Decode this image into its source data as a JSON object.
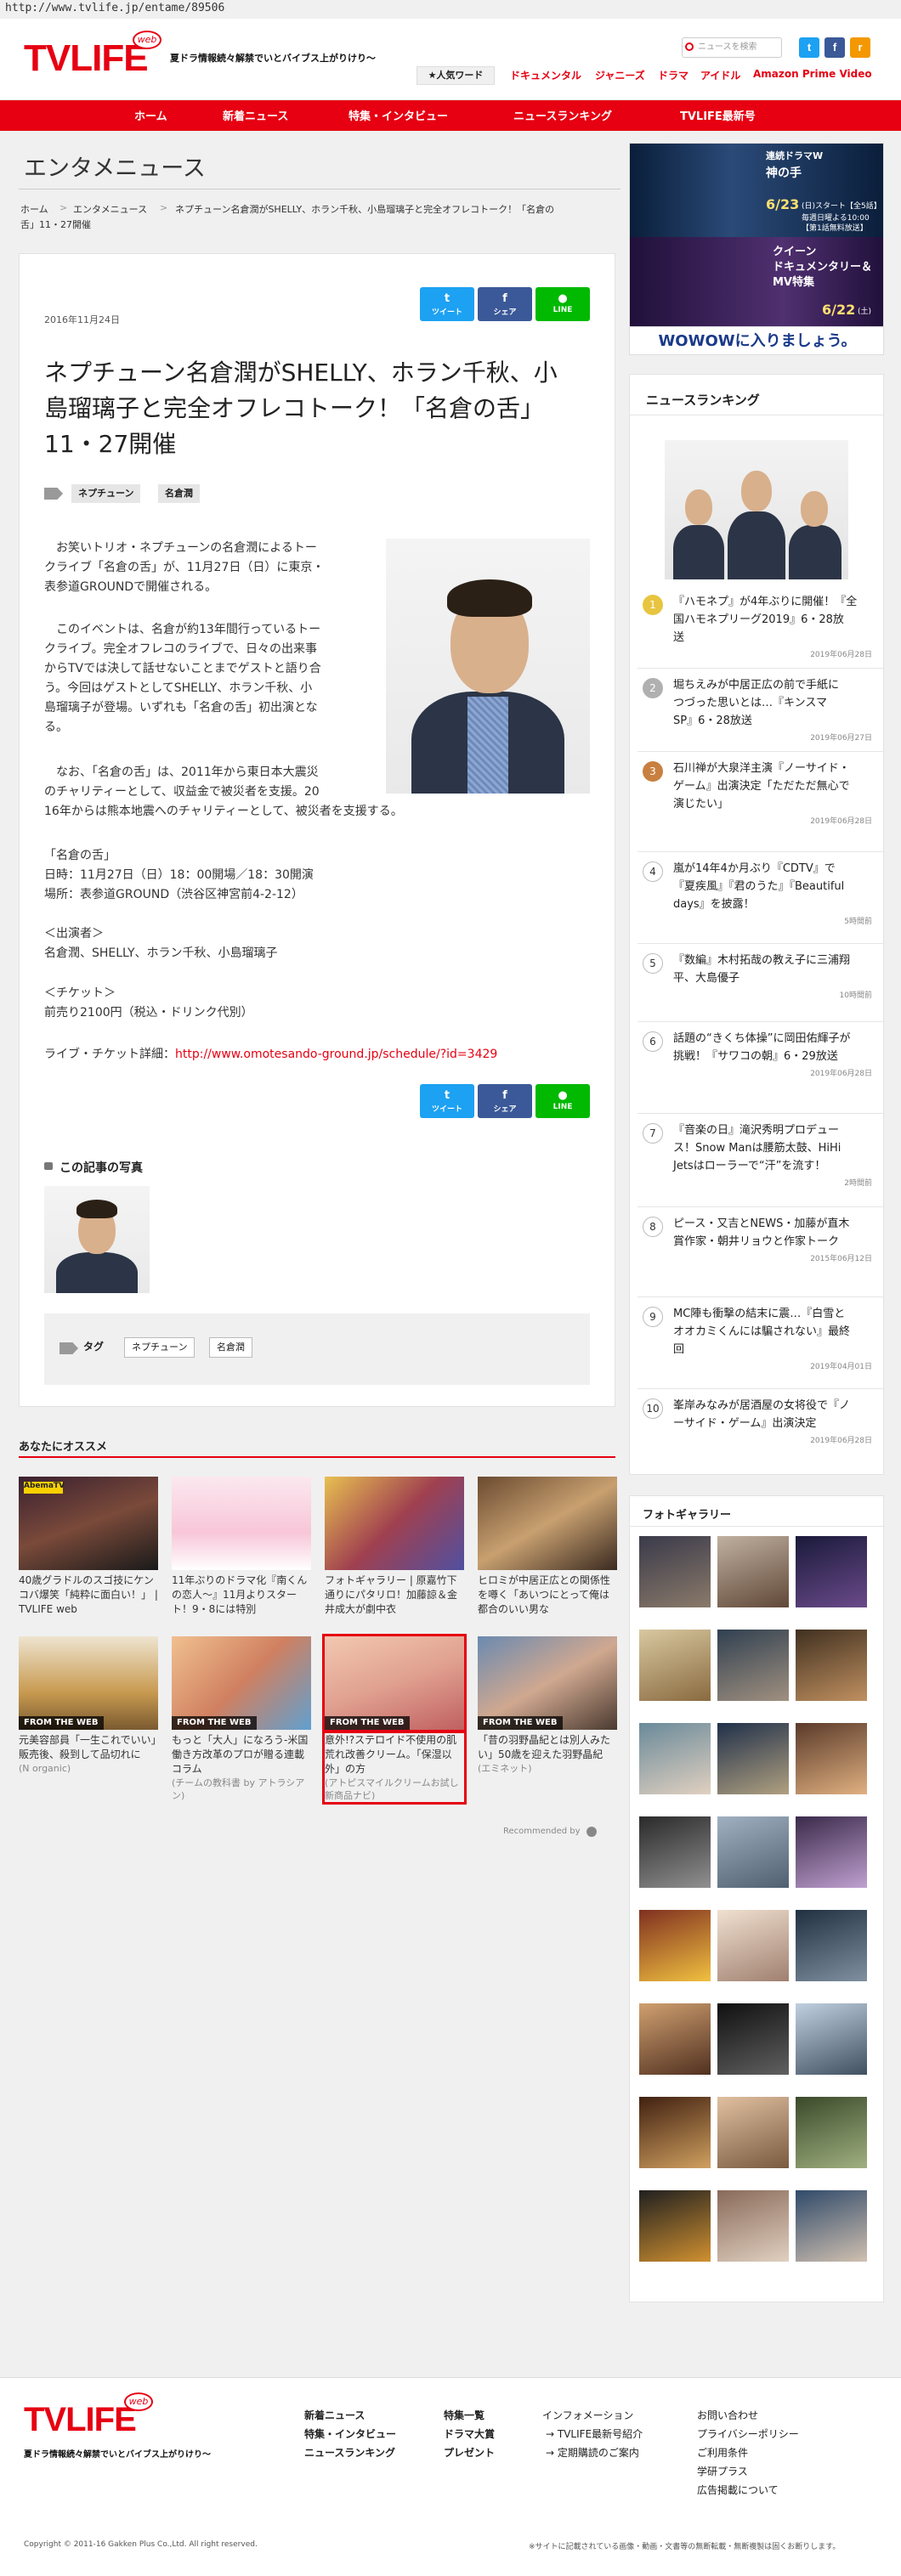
{
  "browser": {
    "url": "http://www.tvlife.jp/entame/89506"
  },
  "header": {
    "logo": "TVLIFE",
    "logo_web": "web",
    "tagline": "夏ドラ情報続々解禁でいとバイブス上がりけり〜",
    "search_placeholder": "ニュースを検索",
    "popular_label": "★人気ワード",
    "categories": [
      "ドキュメンタル",
      "ジャニーズ",
      "ドラマ",
      "アイドル",
      "Amazon Prime Video"
    ],
    "social": {
      "twitter": "t",
      "facebook": "f",
      "rss": "r"
    }
  },
  "nav": {
    "items": [
      "ホーム",
      "新着ニュース",
      "特集・インタビュー",
      "ニュースランキング",
      "TVLIFE最新号"
    ]
  },
  "page_heading": "エンタメニュース",
  "breadcrumb": {
    "home": "ホーム",
    "sep": ">",
    "section": "エンタメニュース",
    "current1": "ネプチューン名倉潤がSHELLY、ホラン千秋、小島瑠璃子と完全オフレコトーク！「名倉の",
    "current2": "舌」11・27開催"
  },
  "article": {
    "date": "2016年11月24日",
    "share": {
      "tweet": "ツイート",
      "share": "シェア",
      "line": "LINE"
    },
    "title": "ネプチューン名倉潤がSHELLY、ホラン千秋、小島瑠璃子と完全オフレコトーク！「名倉の舌」11・27開催",
    "tags": [
      "ネプチューン",
      "名倉潤"
    ],
    "p1_lines": [
      "　お笑いトリオ・ネプチューンの名倉潤によるトー",
      "クライブ「名倉の舌」が、11月27日（日）に東京・",
      "表参道GROUNDで開催される。"
    ],
    "p2_lines": [
      "　このイベントは、名倉が約13年間行っているトー",
      "クライブ。完全オフレコのライブで、日々の出来事",
      "からTVでは決して話せないことまでゲストと語り合",
      "う。今回はゲストとしてSHELLY、ホラン千秋、小",
      "島瑠璃子が登場。いずれも「名倉の舌」初出演とな",
      "る。"
    ],
    "p3_lines": [
      "　なお、「名倉の舌」は、2011年から東日本大震災",
      "のチャリティーとして、収益金で被災者を支援。20",
      "16年からは熊本地震へのチャリティーとして、被災者を支援する。"
    ],
    "event_lines": [
      "「名倉の舌」",
      "日時：11月27日（日）18：00開場／18：30開演",
      "場所：表参道GROUND（渋谷区神宮前4-2-12）"
    ],
    "cast_lines": [
      "＜出演者＞",
      "名倉潤、SHELLY、ホラン千秋、小島瑠璃子"
    ],
    "ticket_lines": [
      "＜チケット＞",
      "前売り2100円（税込・ドリンク代別）"
    ],
    "ticket_link_label": "ライブ・チケット詳細：",
    "ticket_link": "http://www.omotesando-ground.jp/schedule/?id=3429",
    "photos_label": "この記事の写真",
    "tags_label": "タグ"
  },
  "recommend": {
    "heading": "あなたにオススメ",
    "from_web": "FROM THE WEB",
    "items": [
      {
        "lines": [
          "40歳グラドルのスゴ技にケンコバ爆笑「純粋に面白い！」 | TVLIFE web"
        ],
        "sub": ""
      },
      {
        "lines": [
          "11年ぶりのドラマ化『南くんの恋人〜』11月よりスタート！9・8には特別"
        ],
        "sub": ""
      },
      {
        "lines": [
          "フォトギャラリー | 原嘉竹下通りにパタリロ！加藤諒＆金井成大が劇中衣"
        ],
        "sub": ""
      },
      {
        "lines": [
          "ヒロミが中居正広との関係性を噂く「あいつにとって俺は都合のいい男な"
        ],
        "sub": ""
      },
      {
        "lines": [
          "元美容部員「一生これでいい」販売後、殺到して品切れに"
        ],
        "sub": "(N organic)"
      },
      {
        "lines": [
          "もっと「大人」になろう-米国働き方改革のプロが贈る連載コラム"
        ],
        "sub": "(チームの教科書 by アトラシアン)"
      },
      {
        "lines": [
          "意外!?ステロイド不使用の肌荒れ改善クリーム。「保湿以外」の方"
        ],
        "sub": "(アトピスマイルクリームお試し新商品ナビ)"
      },
      {
        "lines": [
          "「昔の羽野晶紀とは別人みたい」50歳を迎えた羽野晶紀"
        ],
        "sub": "(エミネット)"
      }
    ],
    "recommended_by": "Recommended by"
  },
  "sidebar": {
    "ad": {
      "line1": "連続ドラマW",
      "line2": "神の手",
      "date1": "6/23",
      "date1_note": "(日)スタート【全5話】",
      "date1_sub": "毎週日曜よる10:00",
      "date1_sub2": "【第1話無料放送】",
      "line3": "クイーン",
      "line4": "ドキュメンタリー＆",
      "line5": "MV特集",
      "date2": "6/22",
      "date2_note": "(土)",
      "cta": "WOWOWに入りましょう。"
    },
    "ranking": {
      "title": "ニュースランキング",
      "items": [
        {
          "n": "1",
          "text": [
            "『ハモネプ』が4年ぶりに開催！『全",
            "国ハモネプリーグ2019』6・28放",
            "送"
          ],
          "date": "2019年06月28日"
        },
        {
          "n": "2",
          "text": [
            "堀ちえみが中居正広の前で手紙に",
            "つづった思いとは…『キンスマ",
            "SP』6・28放送"
          ],
          "date": "2019年06月27日"
        },
        {
          "n": "3",
          "text": [
            "石川禅が大泉洋主演『ノーサイド・",
            "ゲーム』出演決定「ただただ無心で",
            "演じたい」"
          ],
          "date": "2019年06月28日"
        },
        {
          "n": "4",
          "text": [
            "嵐が14年4か月ぶり『CDTV』で",
            "『夏疾風』『君のうた』『Beautiful",
            "days』を披露！"
          ],
          "date": "5時間前"
        },
        {
          "n": "5",
          "text": [
            "『数編』木村拓哉の教え子に三浦翔",
            "平、大島優子"
          ],
          "date": "10時間前"
        },
        {
          "n": "6",
          "text": [
            "話題の“きくち体操”に岡田佑輝子が",
            "挑戦！『サワコの朝』6・29放送"
          ],
          "date": "2019年06月28日"
        },
        {
          "n": "7",
          "text": [
            "『音楽の日』滝沢秀明プロデュー",
            "ス！Snow Manは腰筋太鼓、HiHi",
            "Jetsはローラーで“汗”を流す！"
          ],
          "date": "2時間前"
        },
        {
          "n": "8",
          "text": [
            "ピース・又吉とNEWS・加藤が直木",
            "賞作家・朝井リョウと作家トーク"
          ],
          "date": "2015年06月12日"
        },
        {
          "n": "9",
          "text": [
            "MC陣も衝撃の結末に震…『白雪と",
            "オオカミくんには騙されない』最終",
            "回"
          ],
          "date": "2019年04月01日"
        },
        {
          "n": "10",
          "text": [
            "峯岸みなみが居酒屋の女将役で『ノ",
            "ーサイド・ゲーム』出演決定"
          ],
          "date": "2019年06月28日"
        }
      ]
    },
    "gallery": {
      "title": "フォトギャラリー"
    }
  },
  "footer": {
    "logo": "TVLIFE",
    "logo_web": "web",
    "tagline": "夏ドラ情報続々解禁でいとバイブス上がりけり〜",
    "col1": [
      "新着ニュース",
      "特集・インタビュー",
      "ニュースランキング"
    ],
    "col2": [
      "特集一覧",
      "ドラマ大賞",
      "プレゼント"
    ],
    "col3": [
      "インフォメーション",
      "→ TVLIFE最新号紹介",
      "→ 定期購読のご案内"
    ],
    "col4": [
      "お問い合わせ",
      "プライバシーポリシー",
      "ご利用条件",
      "学研プラス",
      "広告掲載について"
    ],
    "copyright": "Copyright © 2011-16 Gakken Plus Co.,Ltd. All right reserved.",
    "notice": "※サイトに記載されている画像・動画・文書等の無断転載・無断複製は固くお断りします。"
  },
  "colors": {
    "brand": "#e60012",
    "twitter": "#1da1f2",
    "facebook": "#3b5998",
    "line": "#00b900",
    "rss": "#f39800"
  }
}
